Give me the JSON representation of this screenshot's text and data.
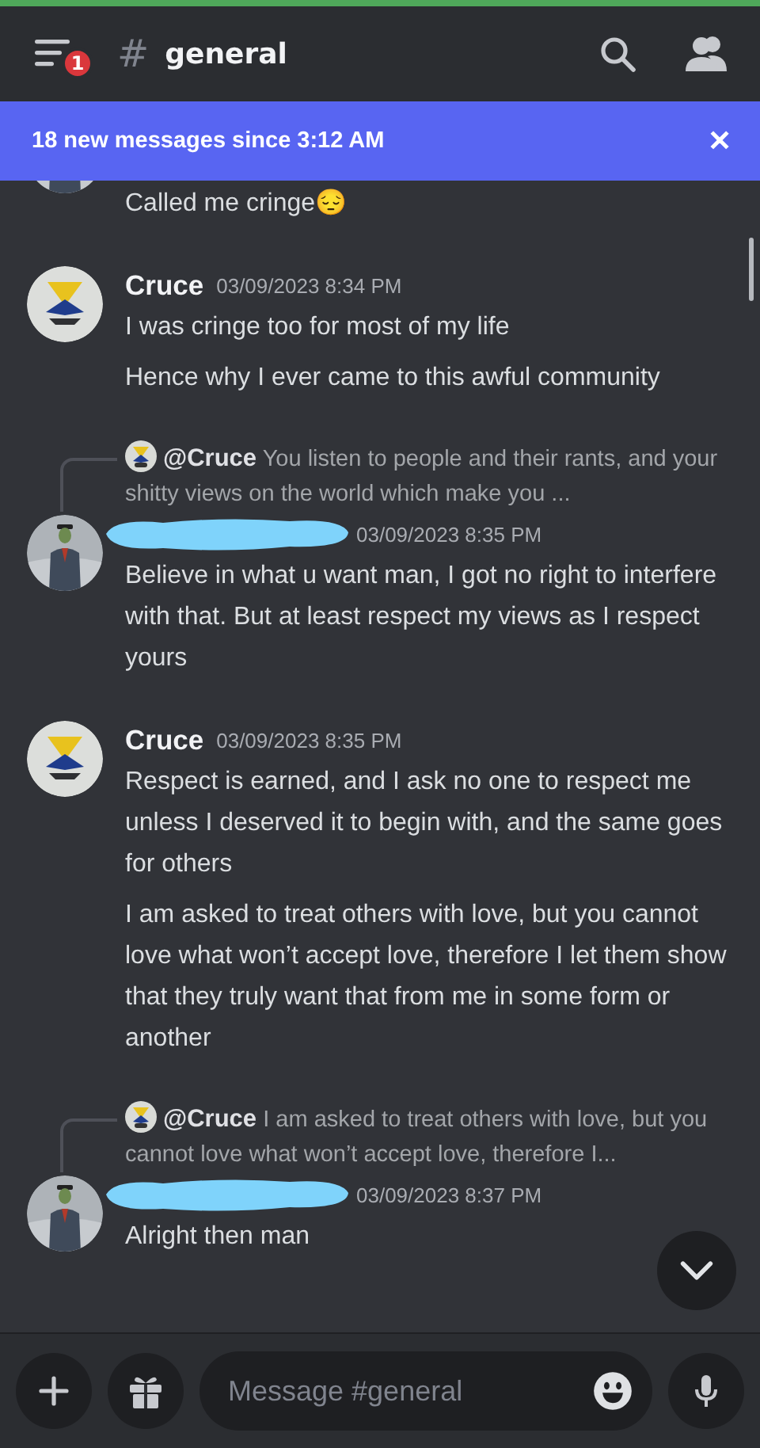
{
  "header": {
    "menu_badge": "1",
    "hash": "#",
    "channel": "general"
  },
  "banner": {
    "text": "18 new messages since 3:12 AM",
    "close": "✕"
  },
  "messages": [
    {
      "kind": "continuation",
      "avatar": {
        "kind": "suited-figure"
      },
      "paragraphs": [
        "Called me cringe😔"
      ]
    },
    {
      "kind": "message",
      "avatar": {
        "kind": "emblem"
      },
      "author": "Cruce",
      "redacted": false,
      "time": "03/09/2023 8:34 PM",
      "paragraphs": [
        "I was cringe too for most of my life",
        "Hence why I ever came to this awful community"
      ]
    },
    {
      "kind": "message",
      "avatar": {
        "kind": "suited-figure"
      },
      "redacted": true,
      "time": "03/09/2023 8:35 PM",
      "reply": {
        "mention": "@Cruce",
        "text": "You listen to people and their rants, and your shitty views on the world which make you ..."
      },
      "paragraphs": [
        "Believe in what u want man, I got no right to interfere with that. But at least respect my views as I respect yours"
      ]
    },
    {
      "kind": "message",
      "avatar": {
        "kind": "emblem"
      },
      "author": "Cruce",
      "redacted": false,
      "time": "03/09/2023 8:35 PM",
      "paragraphs": [
        "Respect is earned, and I ask no one to respect me unless I deserved it to begin with, and the same goes for others",
        "I am asked to treat others with love, but you cannot love what won’t accept love, therefore I let them show that they truly want that from me in some form or another"
      ]
    },
    {
      "kind": "message",
      "avatar": {
        "kind": "suited-figure"
      },
      "redacted": true,
      "time": "03/09/2023 8:37 PM",
      "reply": {
        "mention": "@Cruce",
        "text": "I am asked to treat others with love, but you cannot love what won’t accept love, therefore I..."
      },
      "paragraphs": [
        "Alright then man"
      ]
    }
  ],
  "composer": {
    "placeholder": "Message #general"
  }
}
